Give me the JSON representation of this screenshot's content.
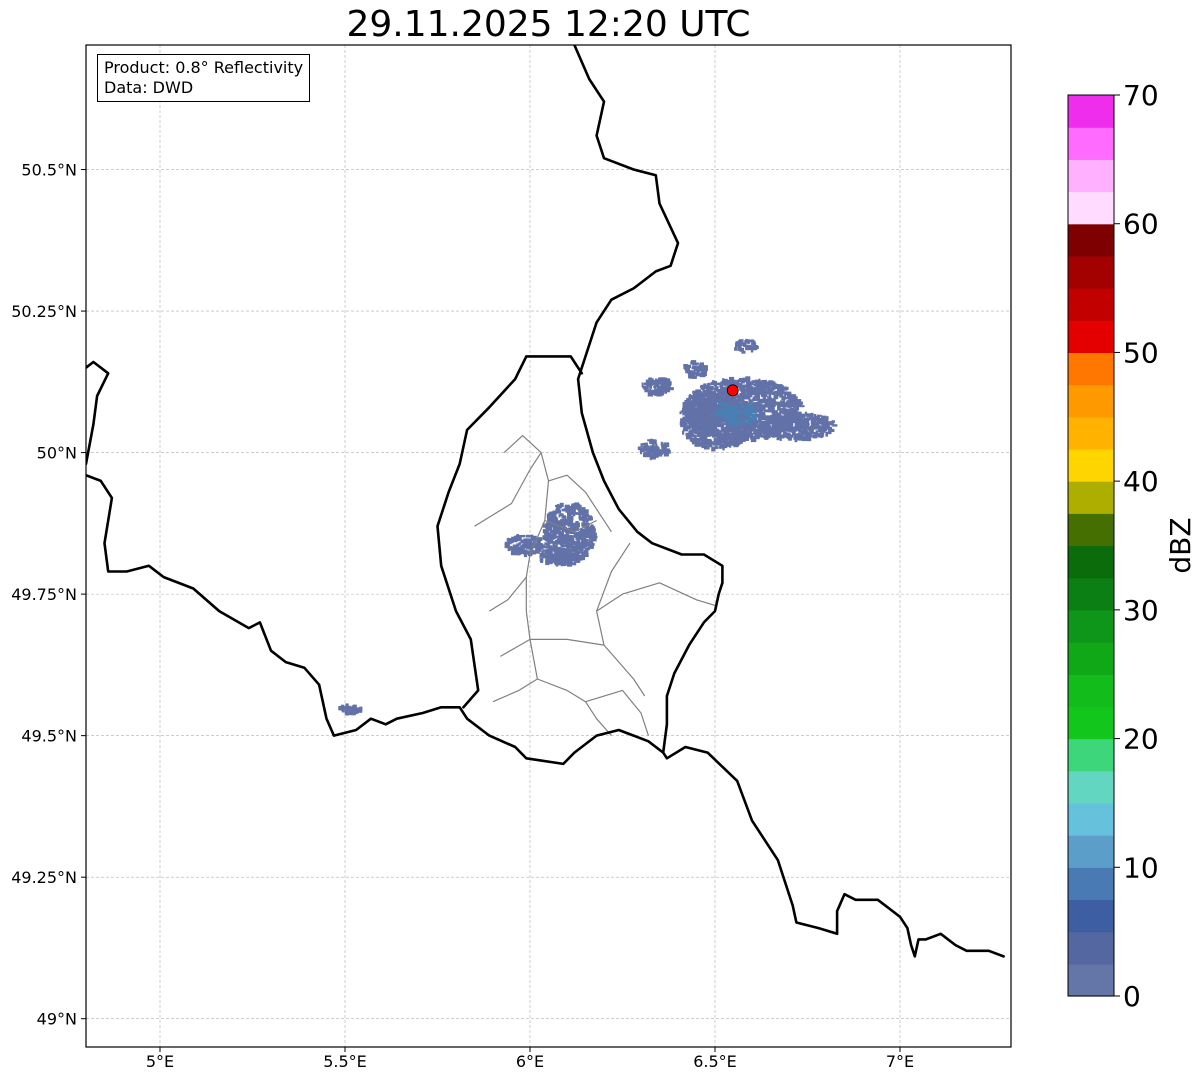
{
  "title": "29.11.2025 12:20 UTC",
  "info_box": {
    "product_line": "Product: 0.8° Reflectivity",
    "data_line": "Data: DWD"
  },
  "map": {
    "lon_range": [
      4.8,
      7.3
    ],
    "lat_range": [
      48.95,
      50.72
    ],
    "lon_ticks": [
      {
        "value": 5.0,
        "label": "5°E"
      },
      {
        "value": 5.5,
        "label": "5.5°E"
      },
      {
        "value": 6.0,
        "label": "6°E"
      },
      {
        "value": 6.5,
        "label": "6.5°E"
      },
      {
        "value": 7.0,
        "label": "7°E"
      }
    ],
    "lat_ticks": [
      {
        "value": 49.0,
        "label": "49°N"
      },
      {
        "value": 49.25,
        "label": "49.25°N"
      },
      {
        "value": 49.5,
        "label": "49.5°N"
      },
      {
        "value": 49.75,
        "label": "49.75°N"
      },
      {
        "value": 50.0,
        "label": "50°N"
      },
      {
        "value": 50.25,
        "label": "50.25°N"
      },
      {
        "value": 50.5,
        "label": "50.5°N"
      }
    ],
    "grid": true,
    "radar_site": {
      "lon": 6.548,
      "lat": 50.11,
      "color": "#ff0000"
    },
    "echo_color": "#6272a8",
    "echo_core_color": "#4a7fb4",
    "echo_areas": [
      {
        "lon": 6.57,
        "lat": 50.08,
        "rlon": 0.16,
        "rlat": 0.055
      },
      {
        "lon": 6.72,
        "lat": 50.05,
        "rlon": 0.1,
        "rlat": 0.025
      },
      {
        "lon": 6.5,
        "lat": 50.06,
        "rlon": 0.1,
        "rlat": 0.05
      },
      {
        "lon": 6.34,
        "lat": 50.12,
        "rlon": 0.04,
        "rlat": 0.015
      },
      {
        "lon": 6.33,
        "lat": 50.01,
        "rlon": 0.04,
        "rlat": 0.015
      },
      {
        "lon": 6.58,
        "lat": 50.19,
        "rlon": 0.03,
        "rlat": 0.012
      },
      {
        "lon": 6.44,
        "lat": 50.15,
        "rlon": 0.03,
        "rlat": 0.014
      },
      {
        "lon": 6.1,
        "lat": 49.86,
        "rlon": 0.07,
        "rlat": 0.055
      },
      {
        "lon": 5.98,
        "lat": 49.84,
        "rlon": 0.05,
        "rlat": 0.018
      },
      {
        "lon": 6.07,
        "lat": 49.82,
        "rlon": 0.05,
        "rlat": 0.014
      },
      {
        "lon": 5.51,
        "lat": 49.55,
        "rlon": 0.03,
        "rlat": 0.008
      }
    ],
    "echo_cores": [
      {
        "lon": 6.56,
        "lat": 50.07,
        "rlon": 0.05,
        "rlat": 0.02
      },
      {
        "lon": 6.51,
        "lat": 50.08,
        "rlon": 0.02,
        "rlat": 0.012
      }
    ],
    "boundaries": {
      "country": [
        [
          [
            7.28,
            49.11
          ],
          [
            7.24,
            49.12
          ],
          [
            7.18,
            49.12
          ],
          [
            7.15,
            49.13
          ],
          [
            7.11,
            49.15
          ],
          [
            7.07,
            49.14
          ],
          [
            7.05,
            49.14
          ],
          [
            7.04,
            49.11
          ],
          [
            7.03,
            49.13
          ],
          [
            7.02,
            49.16
          ],
          [
            7.0,
            49.18
          ],
          [
            6.94,
            49.21
          ],
          [
            6.88,
            49.21
          ],
          [
            6.85,
            49.22
          ],
          [
            6.83,
            49.19
          ],
          [
            6.83,
            49.15
          ],
          [
            6.78,
            49.16
          ],
          [
            6.72,
            49.17
          ],
          [
            6.71,
            49.2
          ],
          [
            6.67,
            49.28
          ],
          [
            6.6,
            49.35
          ],
          [
            6.56,
            49.42
          ],
          [
            6.48,
            49.47
          ],
          [
            6.42,
            49.48
          ],
          [
            6.37,
            49.46
          ],
          [
            6.36,
            49.47
          ],
          [
            6.32,
            49.49
          ],
          [
            6.28,
            49.5
          ],
          [
            6.24,
            49.51
          ],
          [
            6.18,
            49.5
          ],
          [
            6.12,
            49.47
          ],
          [
            6.09,
            49.45
          ],
          [
            5.99,
            49.46
          ],
          [
            5.96,
            49.48
          ],
          [
            5.89,
            49.5
          ],
          [
            5.83,
            49.53
          ],
          [
            5.81,
            49.55
          ],
          [
            5.76,
            49.55
          ],
          [
            5.71,
            49.54
          ],
          [
            5.64,
            49.53
          ],
          [
            5.61,
            49.52
          ],
          [
            5.57,
            49.53
          ],
          [
            5.53,
            49.51
          ],
          [
            5.47,
            49.5
          ],
          [
            5.45,
            49.53
          ],
          [
            5.43,
            49.59
          ],
          [
            5.39,
            49.62
          ],
          [
            5.34,
            49.63
          ],
          [
            5.3,
            49.65
          ],
          [
            5.27,
            49.7
          ],
          [
            5.24,
            49.69
          ],
          [
            5.16,
            49.72
          ],
          [
            5.09,
            49.76
          ],
          [
            5.01,
            49.78
          ],
          [
            4.97,
            49.8
          ],
          [
            4.91,
            49.79
          ],
          [
            4.86,
            49.79
          ],
          [
            4.85,
            49.84
          ],
          [
            4.87,
            49.92
          ],
          [
            4.84,
            49.95
          ],
          [
            4.8,
            49.96
          ]
        ],
        [
          [
            4.8,
            49.98
          ],
          [
            4.82,
            50.05
          ],
          [
            4.83,
            50.1
          ],
          [
            4.86,
            50.14
          ],
          [
            4.82,
            50.16
          ],
          [
            4.8,
            50.15
          ]
        ],
        [
          [
            6.36,
            49.47
          ],
          [
            6.37,
            49.52
          ],
          [
            6.37,
            49.57
          ],
          [
            6.39,
            49.61
          ],
          [
            6.43,
            49.66
          ],
          [
            6.47,
            49.7
          ],
          [
            6.5,
            49.72
          ],
          [
            6.51,
            49.75
          ],
          [
            6.52,
            49.77
          ],
          [
            6.52,
            49.8
          ],
          [
            6.47,
            49.82
          ],
          [
            6.41,
            49.82
          ],
          [
            6.33,
            49.84
          ],
          [
            6.29,
            49.86
          ],
          [
            6.24,
            49.9
          ],
          [
            6.2,
            49.95
          ],
          [
            6.17,
            50.0
          ],
          [
            6.14,
            50.07
          ],
          [
            6.13,
            50.13
          ],
          [
            6.15,
            50.17
          ],
          [
            6.18,
            50.23
          ],
          [
            6.22,
            50.27
          ],
          [
            6.28,
            50.29
          ],
          [
            6.34,
            50.32
          ],
          [
            6.38,
            50.33
          ],
          [
            6.4,
            50.37
          ],
          [
            6.35,
            50.44
          ],
          [
            6.34,
            50.49
          ],
          [
            6.28,
            50.5
          ],
          [
            6.2,
            50.52
          ],
          [
            6.18,
            50.56
          ],
          [
            6.2,
            50.62
          ],
          [
            6.16,
            50.66
          ],
          [
            6.12,
            50.72
          ]
        ],
        [
          [
            6.14,
            50.14
          ],
          [
            6.11,
            50.17
          ],
          [
            6.03,
            50.17
          ],
          [
            5.99,
            50.17
          ],
          [
            5.96,
            50.13
          ],
          [
            5.89,
            50.08
          ],
          [
            5.83,
            50.04
          ],
          [
            5.81,
            49.98
          ],
          [
            5.78,
            49.93
          ],
          [
            5.75,
            49.87
          ],
          [
            5.76,
            49.8
          ],
          [
            5.8,
            49.72
          ],
          [
            5.84,
            49.67
          ],
          [
            5.86,
            49.58
          ],
          [
            5.82,
            49.55
          ]
        ]
      ],
      "canton": [
        [
          [
            5.85,
            49.87
          ],
          [
            5.95,
            49.91
          ],
          [
            6.0,
            49.97
          ],
          [
            6.03,
            50.0
          ]
        ],
        [
          [
            6.03,
            50.0
          ],
          [
            5.98,
            50.03
          ],
          [
            5.93,
            50.0
          ]
        ],
        [
          [
            6.03,
            50.0
          ],
          [
            6.05,
            49.95
          ],
          [
            6.04,
            49.88
          ]
        ],
        [
          [
            6.05,
            49.95
          ],
          [
            6.1,
            49.96
          ],
          [
            6.15,
            49.93
          ],
          [
            6.18,
            49.9
          ],
          [
            6.22,
            49.86
          ]
        ],
        [
          [
            6.04,
            49.88
          ],
          [
            6.12,
            49.86
          ],
          [
            6.18,
            49.88
          ]
        ],
        [
          [
            6.04,
            49.88
          ],
          [
            6.0,
            49.82
          ],
          [
            5.99,
            49.78
          ]
        ],
        [
          [
            5.99,
            49.78
          ],
          [
            5.94,
            49.74
          ],
          [
            5.89,
            49.72
          ]
        ],
        [
          [
            5.99,
            49.78
          ],
          [
            5.99,
            49.72
          ],
          [
            6.0,
            49.67
          ]
        ],
        [
          [
            6.0,
            49.67
          ],
          [
            5.92,
            49.64
          ]
        ],
        [
          [
            6.0,
            49.67
          ],
          [
            6.1,
            49.67
          ],
          [
            6.2,
            49.66
          ],
          [
            6.28,
            49.6
          ],
          [
            6.31,
            49.57
          ]
        ],
        [
          [
            6.2,
            49.66
          ],
          [
            6.18,
            49.72
          ],
          [
            6.25,
            49.75
          ],
          [
            6.35,
            49.77
          ],
          [
            6.45,
            49.74
          ],
          [
            6.5,
            49.73
          ]
        ],
        [
          [
            6.18,
            49.72
          ],
          [
            6.22,
            49.79
          ],
          [
            6.27,
            49.84
          ]
        ],
        [
          [
            6.0,
            49.67
          ],
          [
            6.02,
            49.6
          ],
          [
            5.97,
            49.58
          ],
          [
            5.9,
            49.56
          ]
        ],
        [
          [
            6.02,
            49.6
          ],
          [
            6.1,
            49.58
          ],
          [
            6.15,
            49.56
          ],
          [
            6.18,
            49.53
          ],
          [
            6.22,
            49.5
          ]
        ],
        [
          [
            6.15,
            49.56
          ],
          [
            6.25,
            49.58
          ],
          [
            6.3,
            49.54
          ],
          [
            6.32,
            49.5
          ]
        ]
      ]
    }
  },
  "colorbar": {
    "label": "dBZ",
    "vmin": 0,
    "vmax": 70,
    "tick_labels": [
      "0",
      "10",
      "20",
      "30",
      "40",
      "50",
      "60",
      "70"
    ],
    "colors": [
      "#6475a8",
      "#5467a0",
      "#3e5ea4",
      "#4a7ab4",
      "#5b9ec9",
      "#66c1dd",
      "#63d6c1",
      "#3dd67b",
      "#12c61c",
      "#12bc1a",
      "#10a816",
      "#0e961a",
      "#0b7f14",
      "#0b6c0c",
      "#456f00",
      "#aeae00",
      "#ffd500",
      "#ffb300",
      "#ff9900",
      "#ff7700",
      "#e50000",
      "#c20000",
      "#a30000",
      "#7e0000",
      "#ffdcff",
      "#ffb0ff",
      "#ff6bff",
      "#ee2ded"
    ]
  }
}
